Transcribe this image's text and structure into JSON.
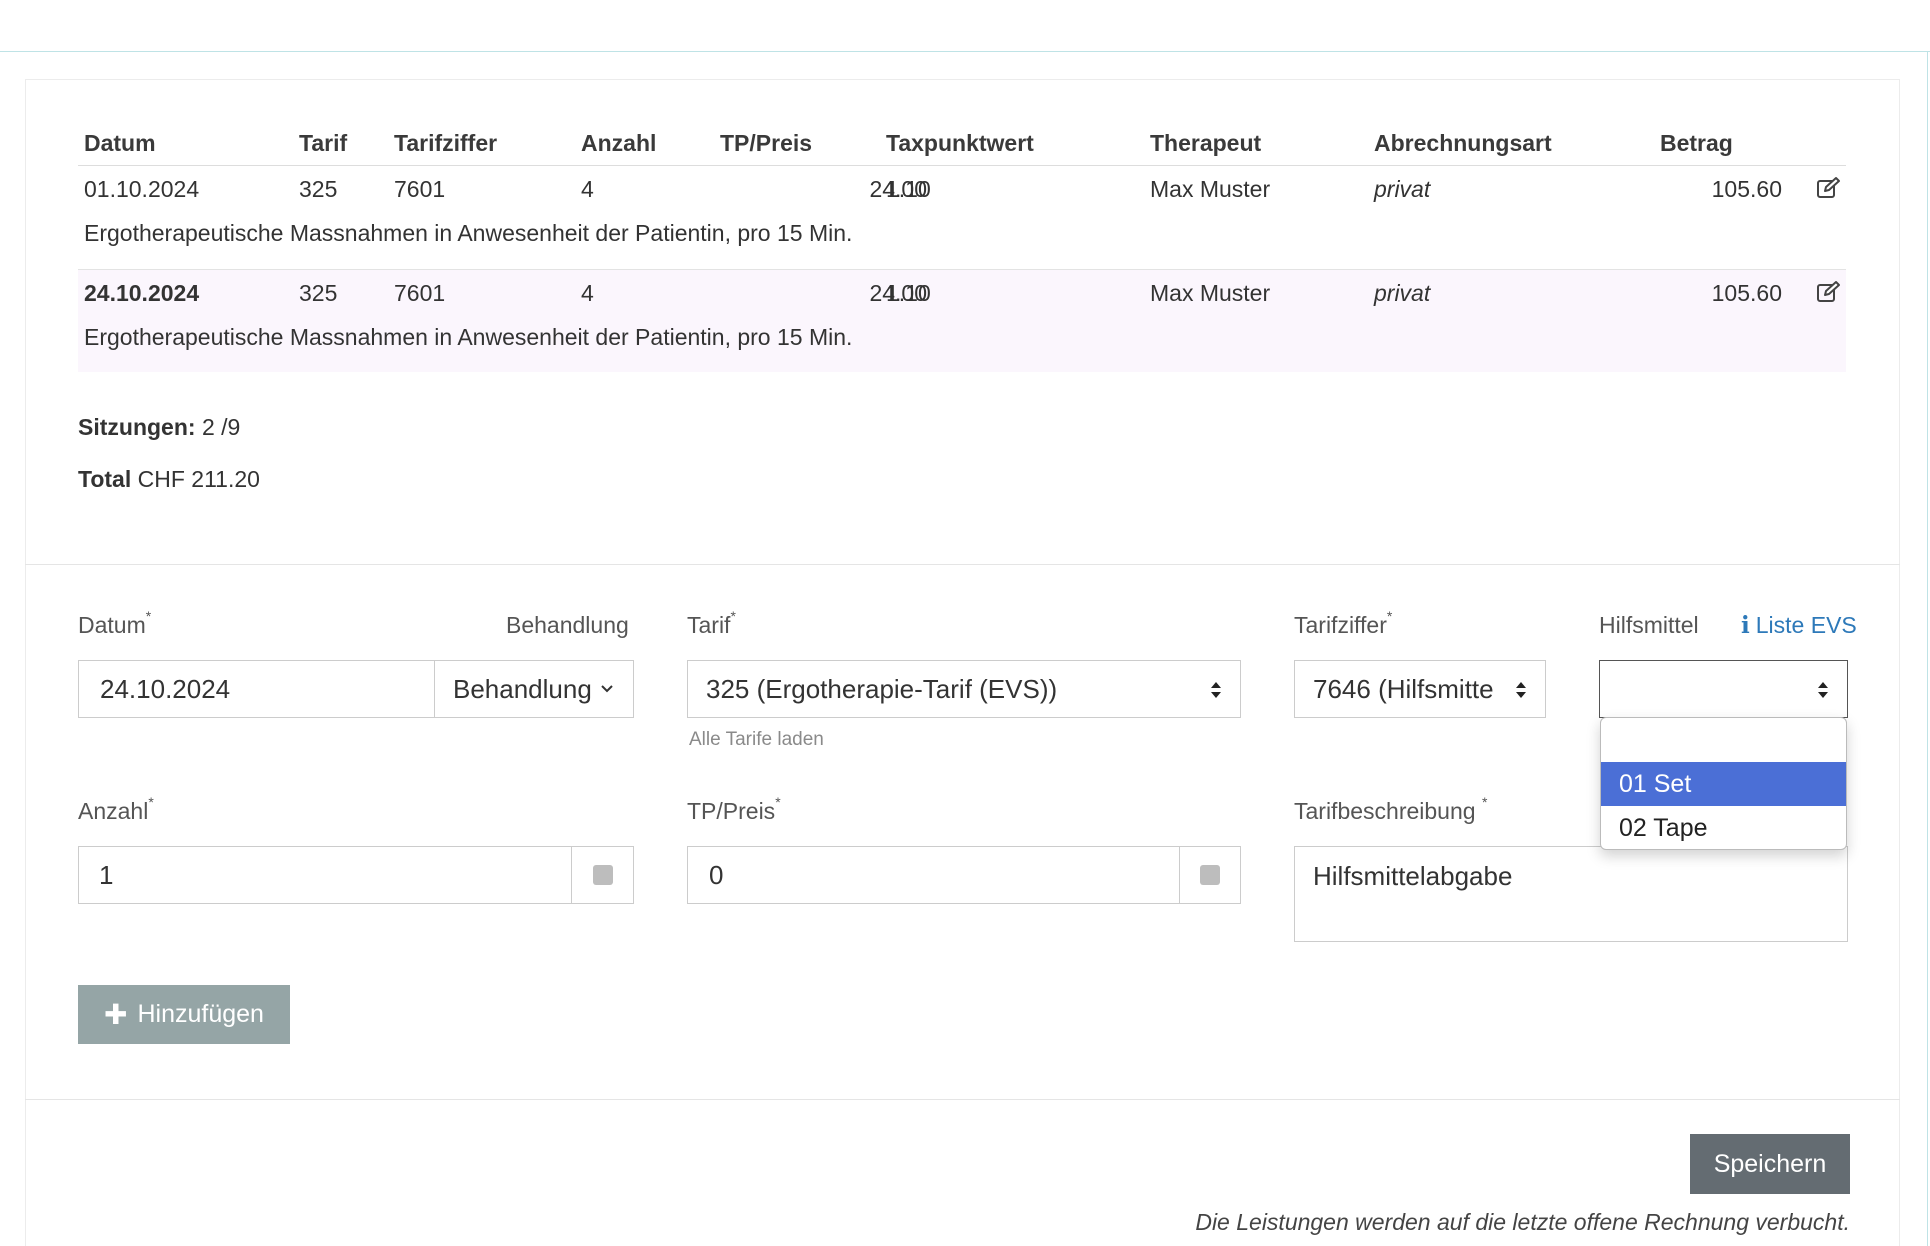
{
  "table": {
    "headers": {
      "datum": "Datum",
      "tarif": "Tarif",
      "tarifziffer": "Tarifziffer",
      "anzahl": "Anzahl",
      "tp_preis": "TP/Preis",
      "taxpunktwert": "Taxpunktwert",
      "therapeut": "Therapeut",
      "abrechnungsart": "Abrechnungsart",
      "betrag": "Betrag"
    },
    "rows": [
      {
        "datum": "01.10.2024",
        "tarif": "325",
        "tarifziffer": "7601",
        "anzahl": "4",
        "tp_preis": "24.00",
        "taxpunktwert": "1.10",
        "therapeut": "Max Muster",
        "abrechnungsart": "privat",
        "betrag": "105.60",
        "beschreibung": "Ergotherapeutische Massnahmen in Anwesenheit der Patientin, pro 15 Min."
      },
      {
        "datum": "24.10.2024",
        "tarif": "325",
        "tarifziffer": "7601",
        "anzahl": "4",
        "tp_preis": "24.00",
        "taxpunktwert": "1.10",
        "therapeut": "Max Muster",
        "abrechnungsart": "privat",
        "betrag": "105.60",
        "beschreibung": "Ergotherapeutische Massnahmen in Anwesenheit der Patientin, pro 15 Min."
      }
    ]
  },
  "summary": {
    "sitzungen_label": "Sitzungen:",
    "sitzungen_value": "2 /9",
    "total_label": "Total",
    "total_value": "CHF 211.20"
  },
  "form": {
    "datum_label": "Datum",
    "datum_value": "24.10.2024",
    "behandlung_label": "Behandlung",
    "behandlung_button": "Behandlung",
    "tarif_label": "Tarif",
    "tarif_value": "325 (Ergotherapie-Tarif (EVS))",
    "alle_tarife": "Alle Tarife laden",
    "tarifziffer_label": "Tarifziffer",
    "tarifziffer_value": "7646 (Hilfsmitte",
    "hilfsmittel_label": "Hilfsmittel",
    "liste_evs": "Liste EVS",
    "hilfsmittel_value": "",
    "hilfsmittel_options": [
      "",
      "01 Set",
      "02 Tape"
    ],
    "anzahl_label": "Anzahl",
    "anzahl_value": "1",
    "tp_preis_label": "TP/Preis",
    "tp_preis_value": "0",
    "tarifbeschreibung_label": "Tarifbeschreibung",
    "tarifbeschreibung_value": "Hilfsmittelabgabe",
    "required_mark": "*"
  },
  "actions": {
    "add_label": "Hinzufügen",
    "save_label": "Speichern",
    "note": "Die Leistungen werden auf die letzte offene Rechnung verbucht."
  },
  "colors": {
    "accent_blue": "#4b6fd6",
    "link_blue": "#2d79b9",
    "add_button": "#95a5a6",
    "save_button": "#646c72",
    "highlight_row": "#fbf6fd"
  }
}
